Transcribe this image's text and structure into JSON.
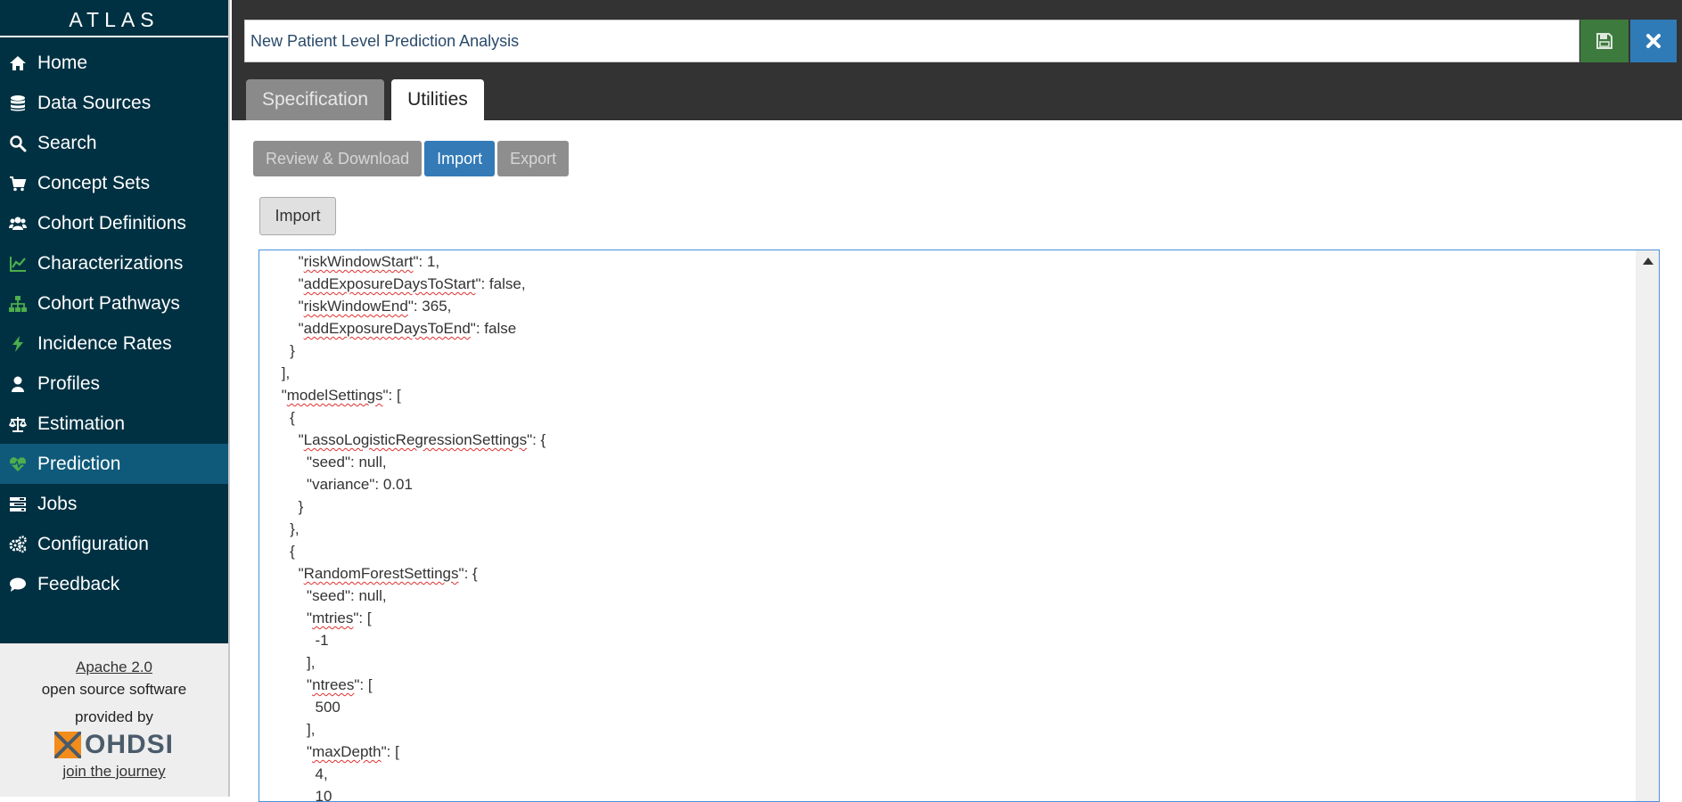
{
  "app": {
    "brand": "ATLAS"
  },
  "sidebar": {
    "items": [
      {
        "label": "Home",
        "icon": "home-icon"
      },
      {
        "label": "Data Sources",
        "icon": "database-icon"
      },
      {
        "label": "Search",
        "icon": "search-icon"
      },
      {
        "label": "Concept Sets",
        "icon": "cart-icon"
      },
      {
        "label": "Cohort Definitions",
        "icon": "users-icon"
      },
      {
        "label": "Characterizations",
        "icon": "line-chart-icon"
      },
      {
        "label": "Cohort Pathways",
        "icon": "sitemap-icon"
      },
      {
        "label": "Incidence Rates",
        "icon": "bolt-icon"
      },
      {
        "label": "Profiles",
        "icon": "user-icon"
      },
      {
        "label": "Estimation",
        "icon": "balance-scale-icon"
      },
      {
        "label": "Prediction",
        "icon": "heartbeat-icon",
        "active": true
      },
      {
        "label": "Jobs",
        "icon": "tasks-icon"
      },
      {
        "label": "Configuration",
        "icon": "cogs-icon"
      },
      {
        "label": "Feedback",
        "icon": "comment-icon"
      }
    ],
    "footer": {
      "license_link": "Apache 2.0",
      "license_text": "open source software",
      "provided_by": "provided by",
      "org_name": "OHDSI",
      "journey_link": "join the journey"
    }
  },
  "header": {
    "title_value": "New Patient Level Prediction Analysis",
    "tabs": [
      {
        "label": "Specification",
        "active": false
      },
      {
        "label": "Utilities",
        "active": true
      }
    ]
  },
  "toolbar": {
    "review_label": "Review & Download",
    "import_label": "Import",
    "export_label": "Export"
  },
  "import_button_label": "Import",
  "colors": {
    "sidebar_bg": "#003142",
    "active_item": "#0f5a7a",
    "header_bg": "#333333",
    "save_green": "#3d7a3d",
    "close_blue": "#2f7bb8",
    "primary_blue": "#337ab7",
    "nav_icon_green": "#4cae4c"
  },
  "editor": {
    "lines": [
      "     \"riskWindowStart\": 1,",
      "     \"addExposureDaysToStart\": false,",
      "     \"riskWindowEnd\": 365,",
      "     \"addExposureDaysToEnd\": false",
      "   }",
      " ],",
      " \"modelSettings\": [",
      "   {",
      "     \"LassoLogisticRegressionSettings\": {",
      "       \"seed\": null,",
      "       \"variance\": 0.01",
      "     }",
      "   },",
      "   {",
      "     \"RandomForestSettings\": {",
      "       \"seed\": null,",
      "       \"mtries\": [",
      "         -1",
      "       ],",
      "       \"ntrees\": [",
      "         500",
      "       ],",
      "       \"maxDepth\": [",
      "         4,",
      "         10"
    ],
    "squiggle_words": [
      "riskWindowStart",
      "addExposureDaysToStart",
      "riskWindowEnd",
      "addExposureDaysToEnd",
      "modelSettings",
      "LassoLogisticRegressionSettings",
      "RandomForestSettings",
      "mtries",
      "ntrees",
      "maxDepth"
    ]
  }
}
